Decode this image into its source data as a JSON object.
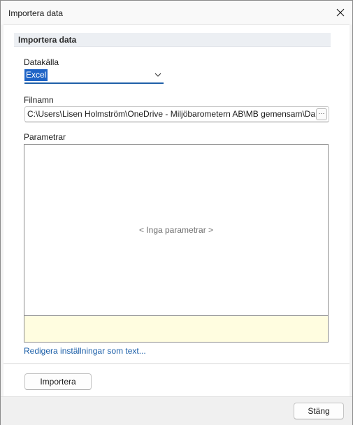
{
  "window": {
    "title": "Importera data"
  },
  "section": {
    "title": "Importera data"
  },
  "datasource": {
    "label": "Datakälla",
    "value": "Excel"
  },
  "filename": {
    "label": "Filnamn",
    "value": "C:\\Users\\Lisen Holmström\\OneDrive - Miljöbarometern AB\\MB gemensam\\Da",
    "browse_label": "···"
  },
  "parameters": {
    "label": "Parametrar",
    "empty_text": "< Inga parametrar >"
  },
  "links": {
    "edit_settings": "Redigera inställningar som text..."
  },
  "buttons": {
    "import": "Importera",
    "close": "Stäng"
  },
  "icons": {
    "close": "close-icon",
    "dropdown": "chevron-down-icon"
  },
  "colors": {
    "accent": "#1f5fa8",
    "selection": "#1f64c6",
    "link": "#1a5ea8",
    "description_bg": "#fffde0"
  }
}
